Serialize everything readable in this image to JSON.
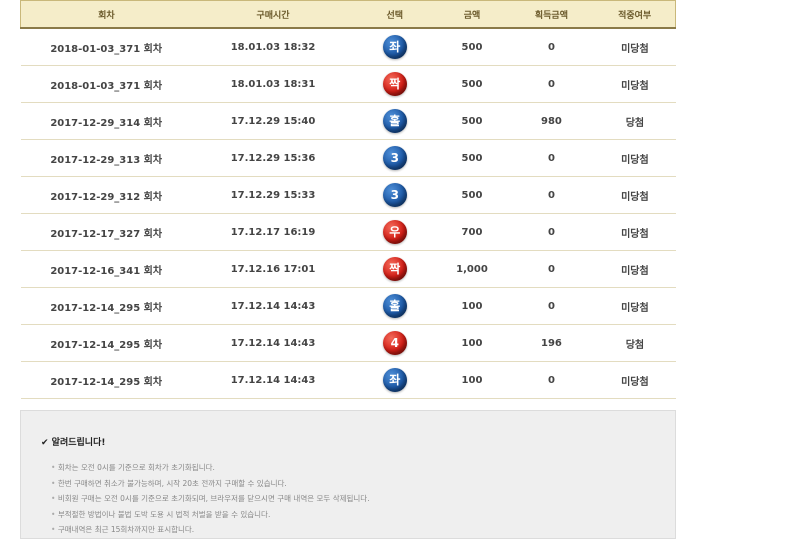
{
  "table": {
    "headers": [
      "회차",
      "구매시간",
      "선택",
      "금액",
      "획득금액",
      "적중여부"
    ],
    "rows": [
      {
        "round": "2018-01-03_371 회차",
        "time": "18.01.03 18:32",
        "pick": "좌",
        "pick_color": "blue",
        "amount": "500",
        "win_amount": "0",
        "result": "미당첨"
      },
      {
        "round": "2018-01-03_371 회차",
        "time": "18.01.03 18:31",
        "pick": "짝",
        "pick_color": "red",
        "amount": "500",
        "win_amount": "0",
        "result": "미당첨"
      },
      {
        "round": "2017-12-29_314 회차",
        "time": "17.12.29 15:40",
        "pick": "홀",
        "pick_color": "blue",
        "amount": "500",
        "win_amount": "980",
        "result": "당첨"
      },
      {
        "round": "2017-12-29_313 회차",
        "time": "17.12.29 15:36",
        "pick": "3",
        "pick_color": "blue",
        "amount": "500",
        "win_amount": "0",
        "result": "미당첨"
      },
      {
        "round": "2017-12-29_312 회차",
        "time": "17.12.29 15:33",
        "pick": "3",
        "pick_color": "blue",
        "amount": "500",
        "win_amount": "0",
        "result": "미당첨"
      },
      {
        "round": "2017-12-17_327 회차",
        "time": "17.12.17 16:19",
        "pick": "우",
        "pick_color": "red",
        "amount": "700",
        "win_amount": "0",
        "result": "미당첨"
      },
      {
        "round": "2017-12-16_341 회차",
        "time": "17.12.16 17:01",
        "pick": "짝",
        "pick_color": "red",
        "amount": "1,000",
        "win_amount": "0",
        "result": "미당첨"
      },
      {
        "round": "2017-12-14_295 회차",
        "time": "17.12.14 14:43",
        "pick": "홀",
        "pick_color": "blue",
        "amount": "100",
        "win_amount": "0",
        "result": "미당첨"
      },
      {
        "round": "2017-12-14_295 회차",
        "time": "17.12.14 14:43",
        "pick": "4",
        "pick_color": "red",
        "amount": "100",
        "win_amount": "196",
        "result": "당첨"
      },
      {
        "round": "2017-12-14_295 회차",
        "time": "17.12.14 14:43",
        "pick": "좌",
        "pick_color": "blue",
        "amount": "100",
        "win_amount": "0",
        "result": "미당첨"
      }
    ]
  },
  "notice": {
    "title": "✔ 알려드립니다!",
    "items": [
      "회차는 오전 0시를 기준으로 회차가 초기화됩니다.",
      "한번 구매하면 취소가 불가능하며, 시작 20초 전까지 구매할 수 있습니다.",
      "비회원 구매는 오전 0시를 기준으로 초기화되며, 브라우저를 닫으시면 구매 내역은 모두 삭제됩니다.",
      "부적절한 방법이나 불법 도박 도용 시 법적 처벌을 받을 수 있습니다.",
      "구매내역은 최근 15회차까지만 표시합니다."
    ]
  },
  "colors": {
    "header_bg": "#f5edc9",
    "header_text": "#6b5a2b",
    "lose": "#e2001a",
    "win": "#1a1ad6",
    "ball_blue": "#1d5aa8",
    "ball_red": "#d51e16"
  }
}
